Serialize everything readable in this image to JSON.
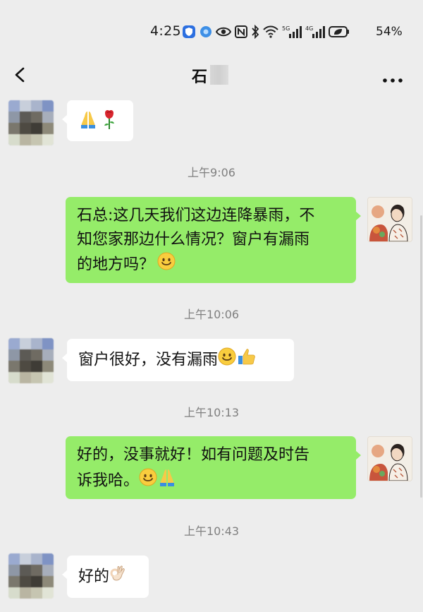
{
  "status_bar": {
    "time": "4:25",
    "battery": "54%",
    "signal_1_label": "5G",
    "signal_2_label": "4G"
  },
  "header": {
    "title": "石"
  },
  "messages": [
    {
      "id": "m1",
      "direction": "in",
      "type": "emoji",
      "text": "",
      "emojis": [
        "folded-hands-emoji",
        "rose-emoji"
      ]
    },
    {
      "id": "t1",
      "type": "timestamp",
      "text": "上午9:06"
    },
    {
      "id": "m2",
      "direction": "out",
      "type": "text",
      "lines": [
        "石总:这几天我们这边连降暴雨，不",
        "知您家那边什么情况？窗户有漏雨",
        "的地方吗？"
      ],
      "emojis": [
        "smile-emoji"
      ]
    },
    {
      "id": "t2",
      "type": "timestamp",
      "text": "上午10:06"
    },
    {
      "id": "m3",
      "direction": "in",
      "type": "text",
      "lines": [
        "窗户很好，没有漏雨"
      ],
      "emojis": [
        "smile-emoji",
        "thumbs-up-emoji"
      ]
    },
    {
      "id": "t3",
      "type": "timestamp",
      "text": "上午10:13"
    },
    {
      "id": "m4",
      "direction": "out",
      "type": "text",
      "lines": [
        "好的，没事就好！如有问题及时告",
        "诉我哈。"
      ],
      "emojis": [
        "smile-emoji",
        "folded-hands-emoji"
      ]
    },
    {
      "id": "t4",
      "type": "timestamp",
      "text": "上午10:43"
    },
    {
      "id": "m5",
      "direction": "in",
      "type": "text",
      "lines": [
        "好的"
      ],
      "emojis": [
        "ok-hand-emoji"
      ]
    }
  ],
  "colors": {
    "background": "#ededed",
    "outgoing_bubble": "#95ec69",
    "incoming_bubble": "#ffffff",
    "timestamp_text": "#7f7f7f"
  }
}
